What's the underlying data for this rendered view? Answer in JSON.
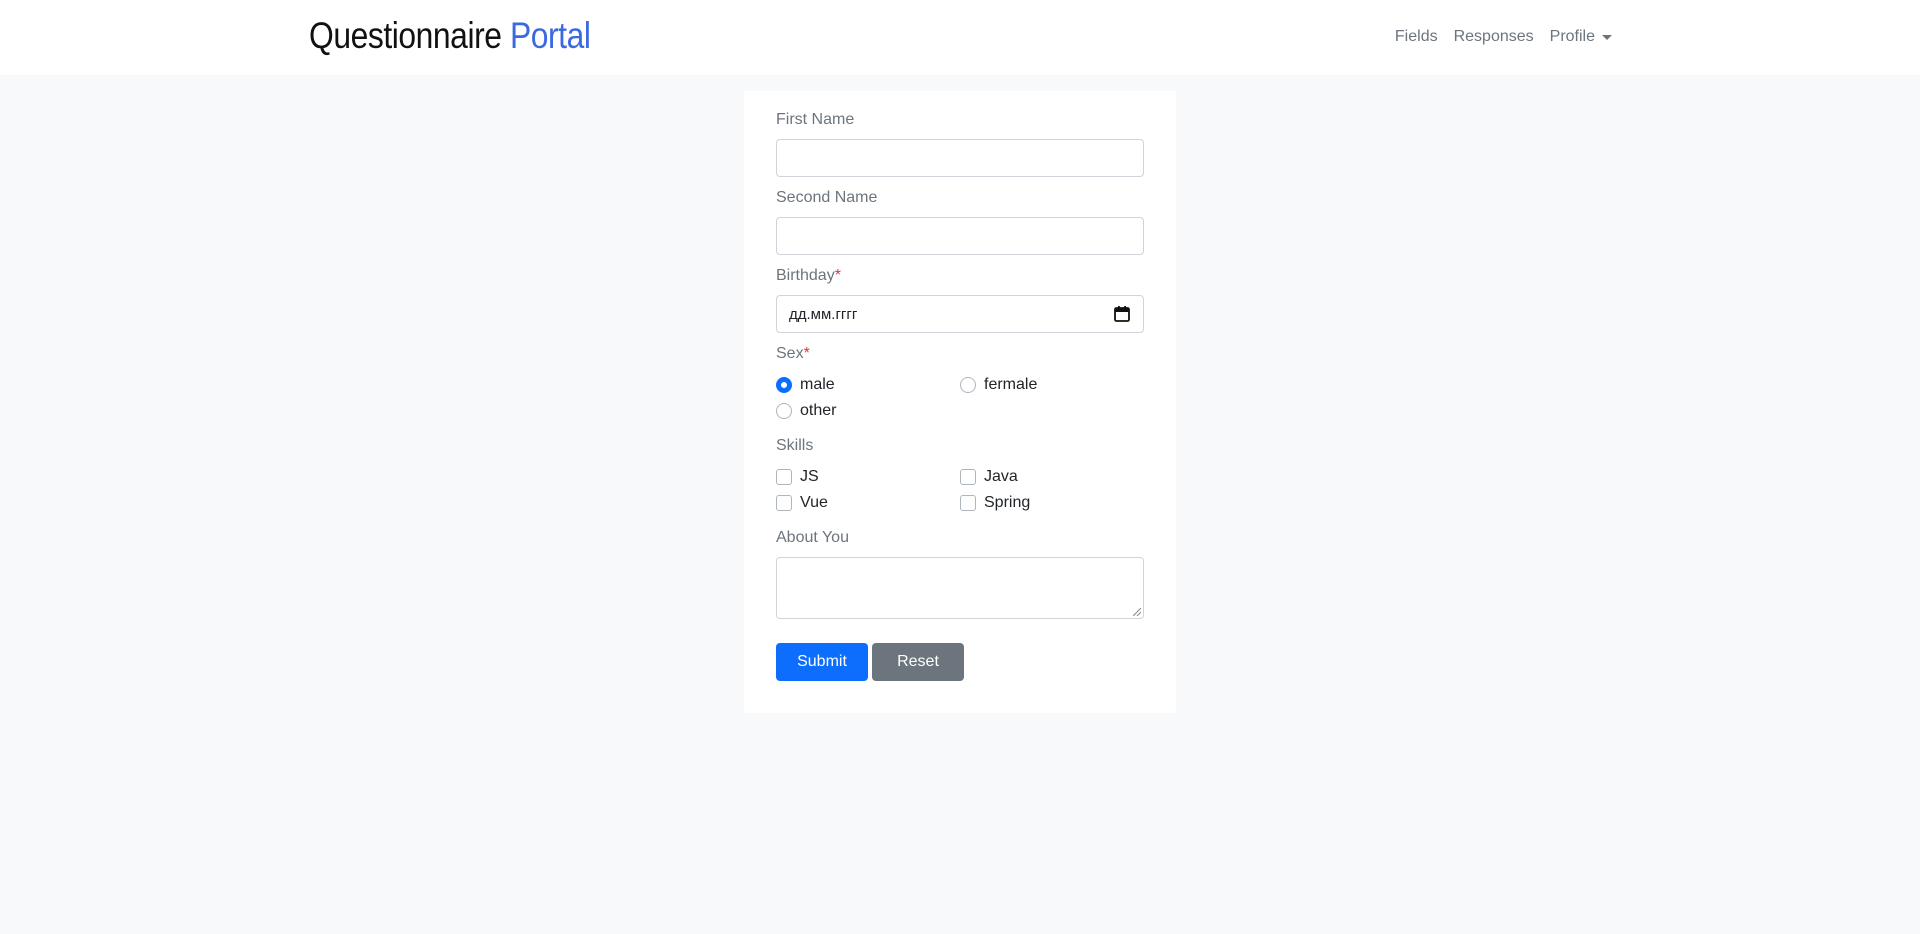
{
  "brand": {
    "title_main": "Questionnaire",
    "title_accent": "Portal"
  },
  "nav": {
    "fields": "Fields",
    "responses": "Responses",
    "profile": "Profile"
  },
  "colors": {
    "accent": "#3b6ae0",
    "primary": "#0d6efd",
    "secondary": "#6c757d",
    "required": "#dc3545",
    "background": "#f8f9fa"
  },
  "form": {
    "first_name": {
      "label": "First Name",
      "value": ""
    },
    "second_name": {
      "label": "Second Name",
      "value": ""
    },
    "birthday": {
      "label": "Birthday",
      "required_mark": "*",
      "placeholder": "дд.мм.гггг",
      "icon": "calendar-icon"
    },
    "sex": {
      "label": "Sex",
      "required_mark": "*",
      "options": [
        {
          "label": "male",
          "checked": true
        },
        {
          "label": "fermale",
          "checked": false
        },
        {
          "label": "other",
          "checked": false
        }
      ]
    },
    "skills": {
      "label": "Skills",
      "options": [
        {
          "label": "JS",
          "checked": false
        },
        {
          "label": "Java",
          "checked": false
        },
        {
          "label": "Vue",
          "checked": false
        },
        {
          "label": "Spring",
          "checked": false
        }
      ]
    },
    "about": {
      "label": "About You",
      "value": ""
    },
    "submit_label": "Submit",
    "reset_label": "Reset"
  }
}
